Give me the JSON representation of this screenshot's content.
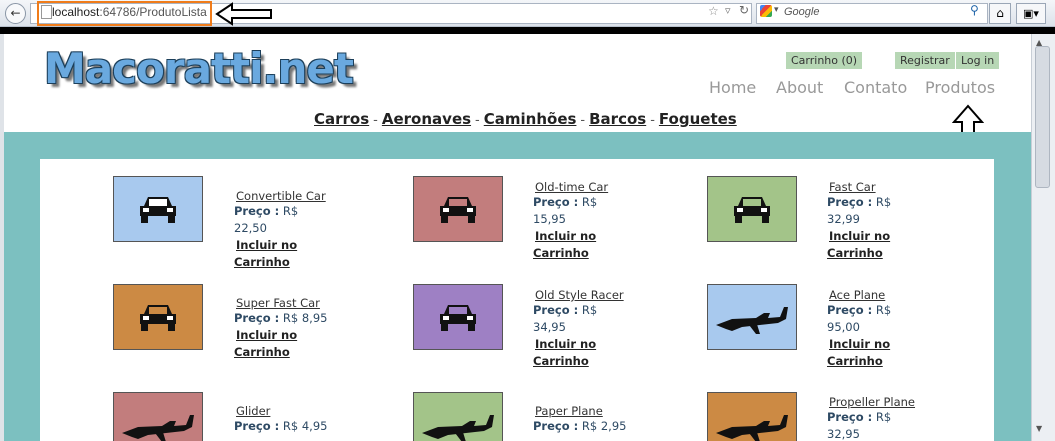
{
  "browser": {
    "url_host": "localhost",
    "url_path": ":64786/ProdutoLista",
    "search_placeholder": "Google"
  },
  "site": {
    "logo": "Macoratti.net",
    "cart_label": "Carrinho (0)",
    "register_label": "Registrar",
    "login_label": "Log in",
    "nav": [
      "Home",
      "About",
      "Contato",
      "Produtos"
    ],
    "categories": [
      "Carros",
      "Aeronaves",
      "Caminhões",
      "Barcos",
      "Foguetes"
    ]
  },
  "products": [
    {
      "name": "Convertible Car",
      "price_label": "Preço :",
      "price": "R$ 22,50",
      "price_cont": "",
      "cart_line1": "Incluir no",
      "cart_line2": "Carrinho",
      "icon": "car-icon",
      "bg": "#a8c9ee"
    },
    {
      "name": "Old-time Car",
      "price_label": "Preço :",
      "price": "R$",
      "price_cont": "15,95",
      "cart_line1": "Incluir no",
      "cart_line2": "Carrinho",
      "icon": "car-icon",
      "bg": "#c27d7d"
    },
    {
      "name": "Fast Car",
      "price_label": "Preço :",
      "price": "R$",
      "price_cont": "32,99",
      "cart_line1": "Incluir no",
      "cart_line2": "Carrinho",
      "icon": "car-icon",
      "bg": "#a3c489"
    },
    {
      "name": "Super Fast Car",
      "price_label": "Preço :",
      "price": "R$ 8,95",
      "price_cont": "",
      "cart_line1": "Incluir no",
      "cart_line2": "Carrinho",
      "icon": "car-icon",
      "bg": "#cc8a44"
    },
    {
      "name": "Old Style Racer",
      "price_label": "Preço :",
      "price": "R$",
      "price_cont": "34,95",
      "cart_line1": "Incluir no",
      "cart_line2": "Carrinho",
      "icon": "car-icon",
      "bg": "#9e80c4"
    },
    {
      "name": "Ace Plane",
      "price_label": "Preço :",
      "price": "R$",
      "price_cont": "95,00",
      "cart_line1": "Incluir no",
      "cart_line2": "Carrinho",
      "icon": "plane-icon",
      "bg": "#a8c9ee"
    },
    {
      "name": "Glider",
      "price_label": "Preço :",
      "price": "R$ 4,95",
      "price_cont": "",
      "cart_line1": "",
      "cart_line2": "",
      "icon": "plane-icon",
      "bg": "#c27d7d"
    },
    {
      "name": "Paper Plane",
      "price_label": "Preço :",
      "price": "R$ 2,95",
      "price_cont": "",
      "cart_line1": "",
      "cart_line2": "",
      "icon": "plane-icon",
      "bg": "#a3c489"
    },
    {
      "name": "Propeller Plane",
      "price_label": "Preço :",
      "price": "R$",
      "price_cont": "32,95",
      "cart_line1": "",
      "cart_line2": "",
      "icon": "plane-icon",
      "bg": "#cc8a44"
    }
  ],
  "colors": {
    "teal": "#7cc0c0",
    "button_green": "#b7d7b5",
    "highlight_orange": "#f07c1a"
  }
}
